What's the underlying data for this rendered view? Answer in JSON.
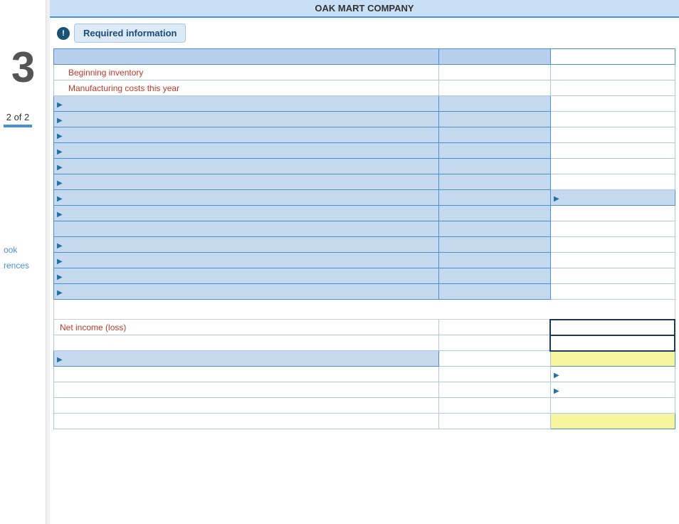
{
  "company": {
    "name": "OAK MART COMPANY"
  },
  "required_info": {
    "label": "Required information"
  },
  "pagination": {
    "text": "2 of 2"
  },
  "big_number": "3",
  "sidebar": {
    "book_label": "ook",
    "references_label": "rences"
  },
  "rows": [
    {
      "type": "header_blue",
      "cols": [
        "",
        "",
        ""
      ]
    },
    {
      "type": "label_red",
      "cols": [
        "Beginning inventory",
        "",
        ""
      ]
    },
    {
      "type": "label_red",
      "cols": [
        "Manufacturing costs this year",
        "",
        ""
      ]
    },
    {
      "type": "arrow_blue",
      "cols": [
        "",
        "",
        ""
      ]
    },
    {
      "type": "arrow_blue",
      "cols": [
        "",
        "",
        ""
      ]
    },
    {
      "type": "arrow_blue",
      "cols": [
        "",
        "",
        ""
      ]
    },
    {
      "type": "arrow_blue",
      "cols": [
        "",
        "",
        ""
      ]
    },
    {
      "type": "arrow_blue",
      "cols": [
        "",
        "",
        ""
      ]
    },
    {
      "type": "arrow_blue",
      "cols": [
        "",
        "",
        ""
      ]
    },
    {
      "type": "arrow_blue",
      "cols": [
        "",
        "",
        ""
      ]
    },
    {
      "type": "arrow_blue_right",
      "cols": [
        "",
        "",
        ""
      ]
    },
    {
      "type": "arrow_blue",
      "cols": [
        "",
        "",
        ""
      ]
    },
    {
      "type": "plain_blue",
      "cols": [
        "",
        "",
        ""
      ]
    },
    {
      "type": "arrow_blue",
      "cols": [
        "",
        "",
        ""
      ]
    },
    {
      "type": "arrow_blue",
      "cols": [
        "",
        "",
        ""
      ]
    },
    {
      "type": "arrow_blue",
      "cols": [
        "",
        "",
        ""
      ]
    },
    {
      "type": "plain_blue_end",
      "cols": [
        "",
        "",
        ""
      ]
    },
    {
      "type": "empty_space",
      "cols": [
        "",
        "",
        ""
      ]
    },
    {
      "type": "net_income",
      "cols": [
        "Net income (loss)",
        "",
        ""
      ]
    },
    {
      "type": "bold_input",
      "cols": [
        "",
        "",
        ""
      ]
    },
    {
      "type": "arrow_highlight",
      "cols": [
        "",
        "",
        ""
      ]
    },
    {
      "type": "arrow_plain2",
      "cols": [
        "",
        "",
        ""
      ]
    },
    {
      "type": "arrow_right2",
      "cols": [
        "",
        "",
        ""
      ]
    },
    {
      "type": "plain_line",
      "cols": [
        "",
        "",
        ""
      ]
    },
    {
      "type": "highlight_bottom",
      "cols": [
        "",
        "",
        ""
      ]
    }
  ]
}
